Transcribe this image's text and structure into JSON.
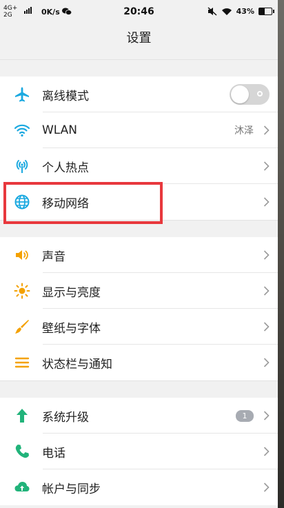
{
  "statusbar": {
    "network_top": "4G+",
    "network_bottom": "2G",
    "speed": "0K/s",
    "time": "20:46",
    "battery": "43%",
    "battery_level": 0.43
  },
  "header": {
    "title": "设置"
  },
  "groups": [
    {
      "items": [
        {
          "label": "离线模式",
          "icon": "airplane-icon",
          "control": "toggle",
          "toggle_on": false
        },
        {
          "label": "WLAN",
          "icon": "wifi-icon",
          "value": "沐泽"
        },
        {
          "label": "个人热点",
          "icon": "hotspot-icon"
        },
        {
          "label": "移动网络",
          "icon": "globe-icon"
        }
      ]
    },
    {
      "items": [
        {
          "label": "声音",
          "icon": "speaker-icon"
        },
        {
          "label": "显示与亮度",
          "icon": "brightness-icon"
        },
        {
          "label": "壁纸与字体",
          "icon": "brush-icon"
        },
        {
          "label": "状态栏与通知",
          "icon": "menu-icon"
        }
      ]
    },
    {
      "items": [
        {
          "label": "系统升级",
          "icon": "upgrade-arrow-icon",
          "badge": "1"
        },
        {
          "label": "电话",
          "icon": "phone-icon"
        },
        {
          "label": "帐户与同步",
          "icon": "cloud-sync-icon"
        }
      ]
    }
  ],
  "colors": {
    "accent": "#1ba9e0",
    "warning": "#f4a100",
    "green": "#21b37a",
    "highlight": "#e8383d"
  }
}
